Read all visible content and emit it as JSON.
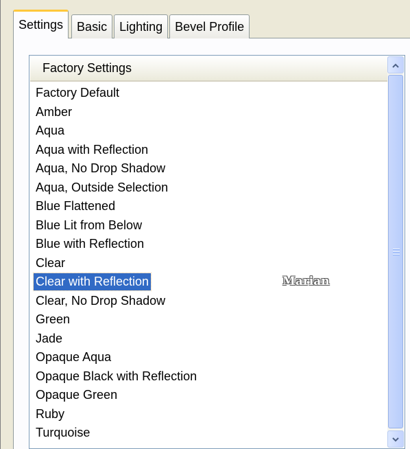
{
  "tabs": [
    {
      "label": "Settings",
      "active": true
    },
    {
      "label": "Basic",
      "active": false
    },
    {
      "label": "Lighting",
      "active": false
    },
    {
      "label": "Bevel Profile",
      "active": false
    }
  ],
  "list": {
    "header": "Factory Settings",
    "items": [
      "Factory Default",
      "Amber",
      "Aqua",
      "Aqua with Reflection",
      "Aqua, No Drop Shadow",
      "Aqua, Outside Selection",
      "Blue Flattened",
      "Blue Lit from Below",
      "Blue with Reflection",
      "Clear",
      "Clear with Reflection",
      "Clear, No Drop Shadow",
      "Green",
      "Jade",
      "Opaque Aqua",
      "Opaque Black with Reflection",
      "Opaque Green",
      "Ruby",
      "Turquoise"
    ],
    "selected": "Clear with Reflection"
  },
  "watermark": "Marian",
  "scrollbar": {
    "up_icon": "chevron-up-icon",
    "down_icon": "chevron-down-icon"
  },
  "colors": {
    "selection": "#316ac5",
    "active_tab_accent": "#ffc83c"
  }
}
